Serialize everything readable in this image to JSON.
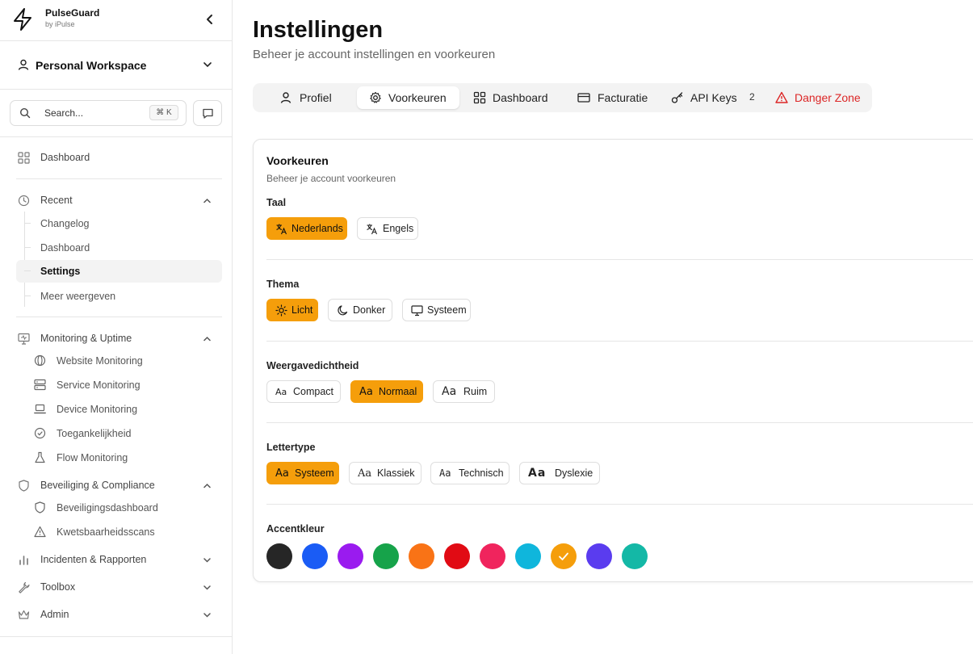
{
  "brand": {
    "name": "PulseGuard",
    "byline": "by iPulse"
  },
  "workspace": {
    "label": "Personal Workspace"
  },
  "search": {
    "placeholder": "Search...",
    "shortcut": "⌘ K"
  },
  "sidebar": {
    "dashboard": "Dashboard",
    "recent": {
      "label": "Recent",
      "items": [
        "Changelog",
        "Dashboard",
        "Settings",
        "Meer weergeven"
      ]
    },
    "monitoring": {
      "label": "Monitoring & Uptime",
      "items": [
        "Website Monitoring",
        "Service Monitoring",
        "Device Monitoring",
        "Toegankelijkheid",
        "Flow Monitoring"
      ]
    },
    "security": {
      "label": "Beveiliging & Compliance",
      "items": [
        "Beveiligingsdashboard",
        "Kwetsbaarheidsscans"
      ]
    },
    "incidents": "Incidenten & Rapporten",
    "toolbox": "Toolbox",
    "admin": "Admin"
  },
  "page": {
    "title": "Instellingen",
    "subtitle": "Beheer je account instellingen en voorkeuren"
  },
  "tabs": {
    "profiel": "Profiel",
    "voorkeuren": "Voorkeuren",
    "dashboard": "Dashboard",
    "facturatie": "Facturatie",
    "apikeys": "API Keys",
    "apikeys_count": "2",
    "danger": "Danger Zone"
  },
  "card": {
    "title": "Voorkeuren",
    "subtitle": "Beheer je account voorkeuren",
    "taal": {
      "label": "Taal",
      "options": [
        "Nederlands",
        "Engels"
      ],
      "selected": "Nederlands"
    },
    "thema": {
      "label": "Thema",
      "options": [
        "Licht",
        "Donker",
        "Systeem"
      ],
      "selected": "Licht"
    },
    "dichtheid": {
      "label": "Weergavedichtheid",
      "options": [
        "Compact",
        "Normaal",
        "Ruim"
      ],
      "selected": "Normaal",
      "glyph": "Aa"
    },
    "lettertype": {
      "label": "Lettertype",
      "options": [
        "Systeem",
        "Klassiek",
        "Technisch",
        "Dyslexie"
      ],
      "selected": "Systeem",
      "glyph": "Aa"
    },
    "accent": {
      "label": "Accentkleur",
      "colors": [
        "#262626",
        "#1a5cf5",
        "#9a1bef",
        "#16a34a",
        "#f97316",
        "#e10b14",
        "#f0245d",
        "#0fb6dc",
        "#f59e0b",
        "#5a3cef",
        "#14b8a6"
      ],
      "selected": "#f59e0b"
    }
  },
  "colors": {
    "accent": "#f59e0b",
    "danger": "#dc2626"
  }
}
